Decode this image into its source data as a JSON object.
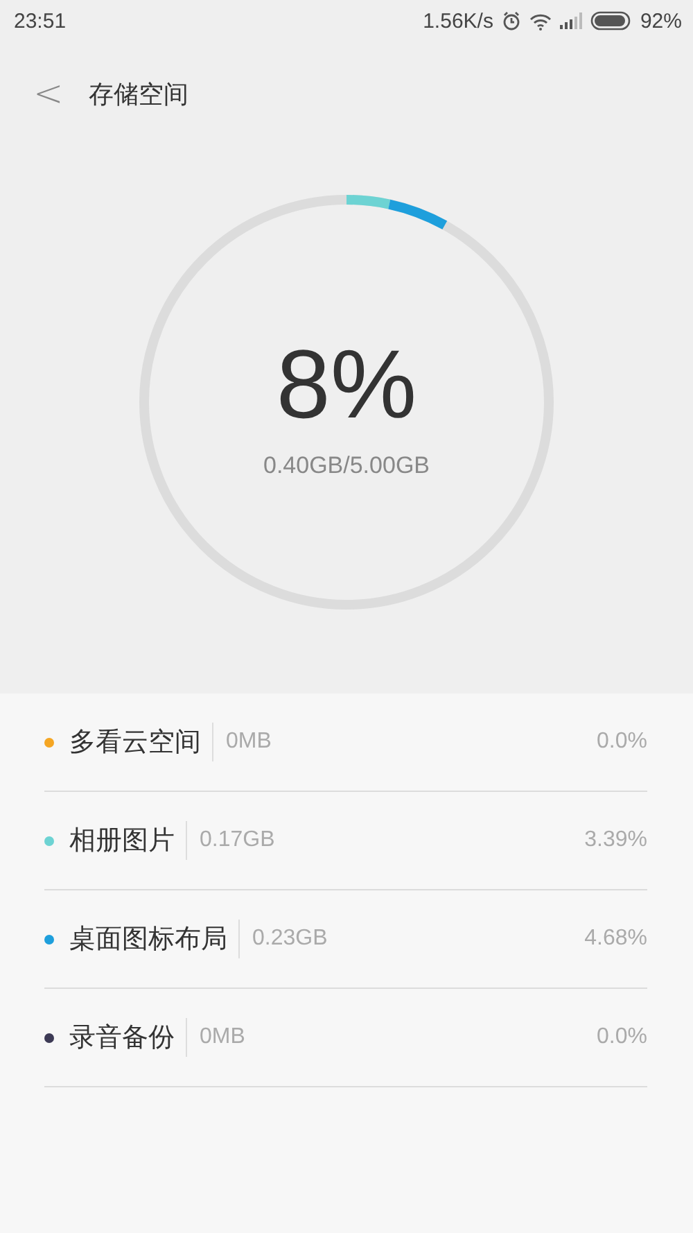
{
  "status_bar": {
    "time": "23:51",
    "speed": "1.56K/s",
    "battery": "92%"
  },
  "header": {
    "back": "<",
    "title": "存储空间"
  },
  "usage": {
    "percent": "8%",
    "amount": "0.40GB/5.00GB"
  },
  "categories": [
    {
      "name": "多看云空间",
      "size": "0MB",
      "share": "0.0%",
      "color": "#f5a623"
    },
    {
      "name": "相册图片",
      "size": "0.17GB",
      "share": "3.39%",
      "color": "#6dd3d3"
    },
    {
      "name": "桌面图标布局",
      "size": "0.23GB",
      "share": "4.68%",
      "color": "#1e9fdc"
    },
    {
      "name": "录音备份",
      "size": "0MB",
      "share": "0.0%",
      "color": "#3d3a55"
    }
  ]
}
